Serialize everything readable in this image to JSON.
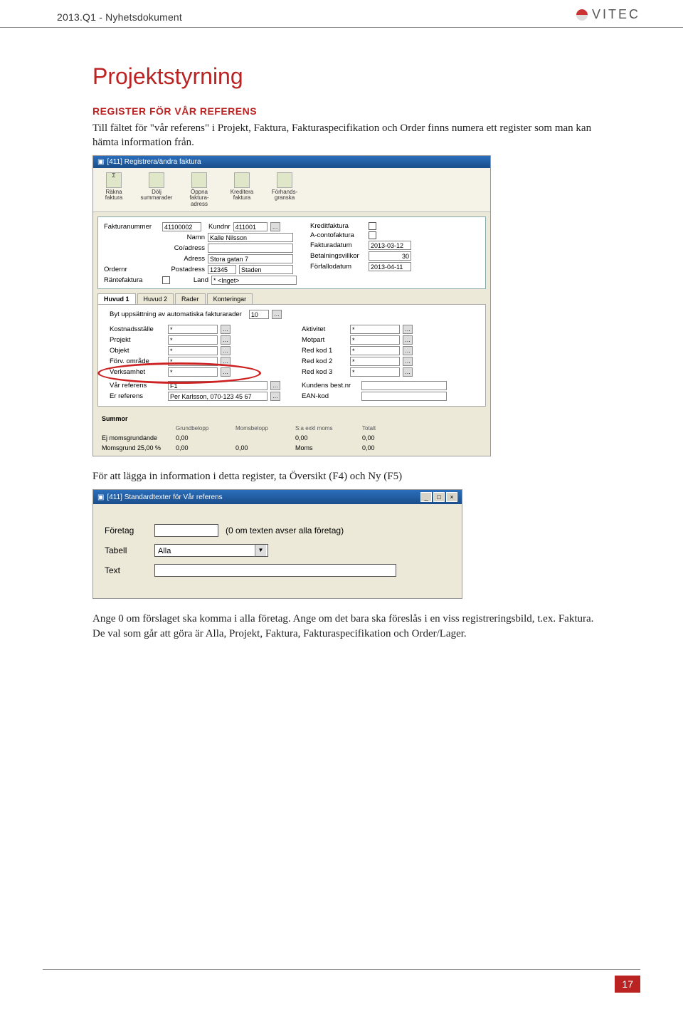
{
  "header": {
    "doc_title": "2013.Q1 - Nyhetsdokument",
    "logo_text": "VITEC"
  },
  "section": {
    "title": "Projektstyrning",
    "subtitle": "REGISTER FÖR VÅR REFERENS",
    "para1": "Till fältet för \"vår referens\" i Projekt, Faktura, Fakturaspecifikation och Order finns numera ett register som man kan hämta information från.",
    "para2": "För att lägga in information i detta register, ta Översikt (F4) och Ny (F5)",
    "para3": "Ange 0 om förslaget ska komma i alla företag. Ange om det bara ska föreslås i en viss registreringsbild, t.ex. Faktura. De val som går att göra är Alla, Projekt, Faktura, Fakturaspecifikation och Order/Lager."
  },
  "ss1": {
    "title": "[411] Registrera/ändra faktura",
    "tools": {
      "t1a": "Räkna",
      "t1b": "faktura",
      "t2a": "Dölj",
      "t2b": "summarader",
      "t3a": "Öppna",
      "t3b": "faktura-",
      "t3c": "adress",
      "t4a": "Kreditera",
      "t4b": "faktura",
      "t5a": "Förhands-",
      "t5b": "granska"
    },
    "labels": {
      "fakturanr": "Fakturanummer",
      "kundnr": "Kundnr",
      "namn": "Namn",
      "coadress": "Co/adress",
      "adress": "Adress",
      "postadress": "Postadress",
      "land": "Land",
      "ordernr": "Ordernr",
      "rantefaktura": "Räntefaktura",
      "kreditfaktura": "Kreditfaktura",
      "acontofaktura": "A-contofaktura",
      "fakturadatum": "Fakturadatum",
      "betvillkor": "Betalningsvillkor",
      "forfallo": "Förfallodatum"
    },
    "values": {
      "fakturanr": "41100002",
      "kundnr": "411001",
      "namn": "Kalle Nilsson",
      "adress": "Stora gatan 7",
      "postnr": "12345",
      "ort": "Staden",
      "land": "* <Inget>",
      "fakturadatum": "2013-03-12",
      "betvillkor": "30",
      "forfallo": "2013-04-11"
    },
    "tabs": {
      "t1": "Huvud 1",
      "t2": "Huvud 2",
      "t3": "Rader",
      "t4": "Konteringar"
    },
    "panel": {
      "byt": "Byt uppsättning av automatiska fakturarader",
      "bytval": "10",
      "kost": "Kostnadsställe",
      "projekt": "Projekt",
      "objekt": "Objekt",
      "forv": "Förv. område",
      "verk": "Verksamhet",
      "aktivitet": "Aktivitet",
      "motpart": "Motpart",
      "red1": "Red kod 1",
      "red2": "Red kod 2",
      "red3": "Red kod 3",
      "varref": "Vår referens",
      "erref": "Er referens",
      "kundbest": "Kundens best.nr",
      "eankod": "EAN-kod",
      "varref_val": "F1",
      "erref_val": "Per Karlsson, 070-123 45 67"
    },
    "summor": {
      "title": "Summor",
      "hdr_grund": "Grundbelopp",
      "hdr_moms": "Momsbelopp",
      "hdr_saexkl": "S:a exkl moms",
      "hdr_total": "Totalt",
      "r1": "Ej momsgrundande",
      "r2": "Momsgrund 25,00 %",
      "v0": "0,00",
      "hmoms": "Moms"
    }
  },
  "ss2": {
    "title": "[411] Standardtexter för Vår referens",
    "lbl_foretag": "Företag",
    "hint_foretag": "(0 om texten avser alla företag)",
    "lbl_tabell": "Tabell",
    "val_tabell": "Alla",
    "lbl_text": "Text"
  },
  "page_num": "17"
}
